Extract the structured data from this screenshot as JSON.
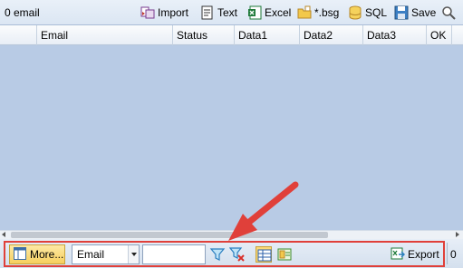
{
  "toolbar": {
    "count_label": "0 email",
    "buttons": [
      {
        "label": "Import",
        "icon": "import-icon"
      },
      {
        "label": "Text",
        "icon": "text-file-icon"
      },
      {
        "label": "Excel",
        "icon": "excel-icon"
      },
      {
        "label": "*.bsg",
        "icon": "bsg-folder-icon"
      },
      {
        "label": "SQL",
        "icon": "database-icon"
      },
      {
        "label": "Save",
        "icon": "save-icon"
      }
    ],
    "search_icon": "search-icon"
  },
  "grid": {
    "columns": [
      "",
      "Email",
      "Status",
      "Data1",
      "Data2",
      "Data3",
      "OK"
    ]
  },
  "bottom": {
    "more_label": "More...",
    "field_select_value": "Email",
    "filter_value": "",
    "export_label": "Export",
    "right_count": "0"
  },
  "colors": {
    "highlight": "#e0403a",
    "grid_background": "#b8cbe5",
    "accent_yellow": "#f6cf5e"
  }
}
